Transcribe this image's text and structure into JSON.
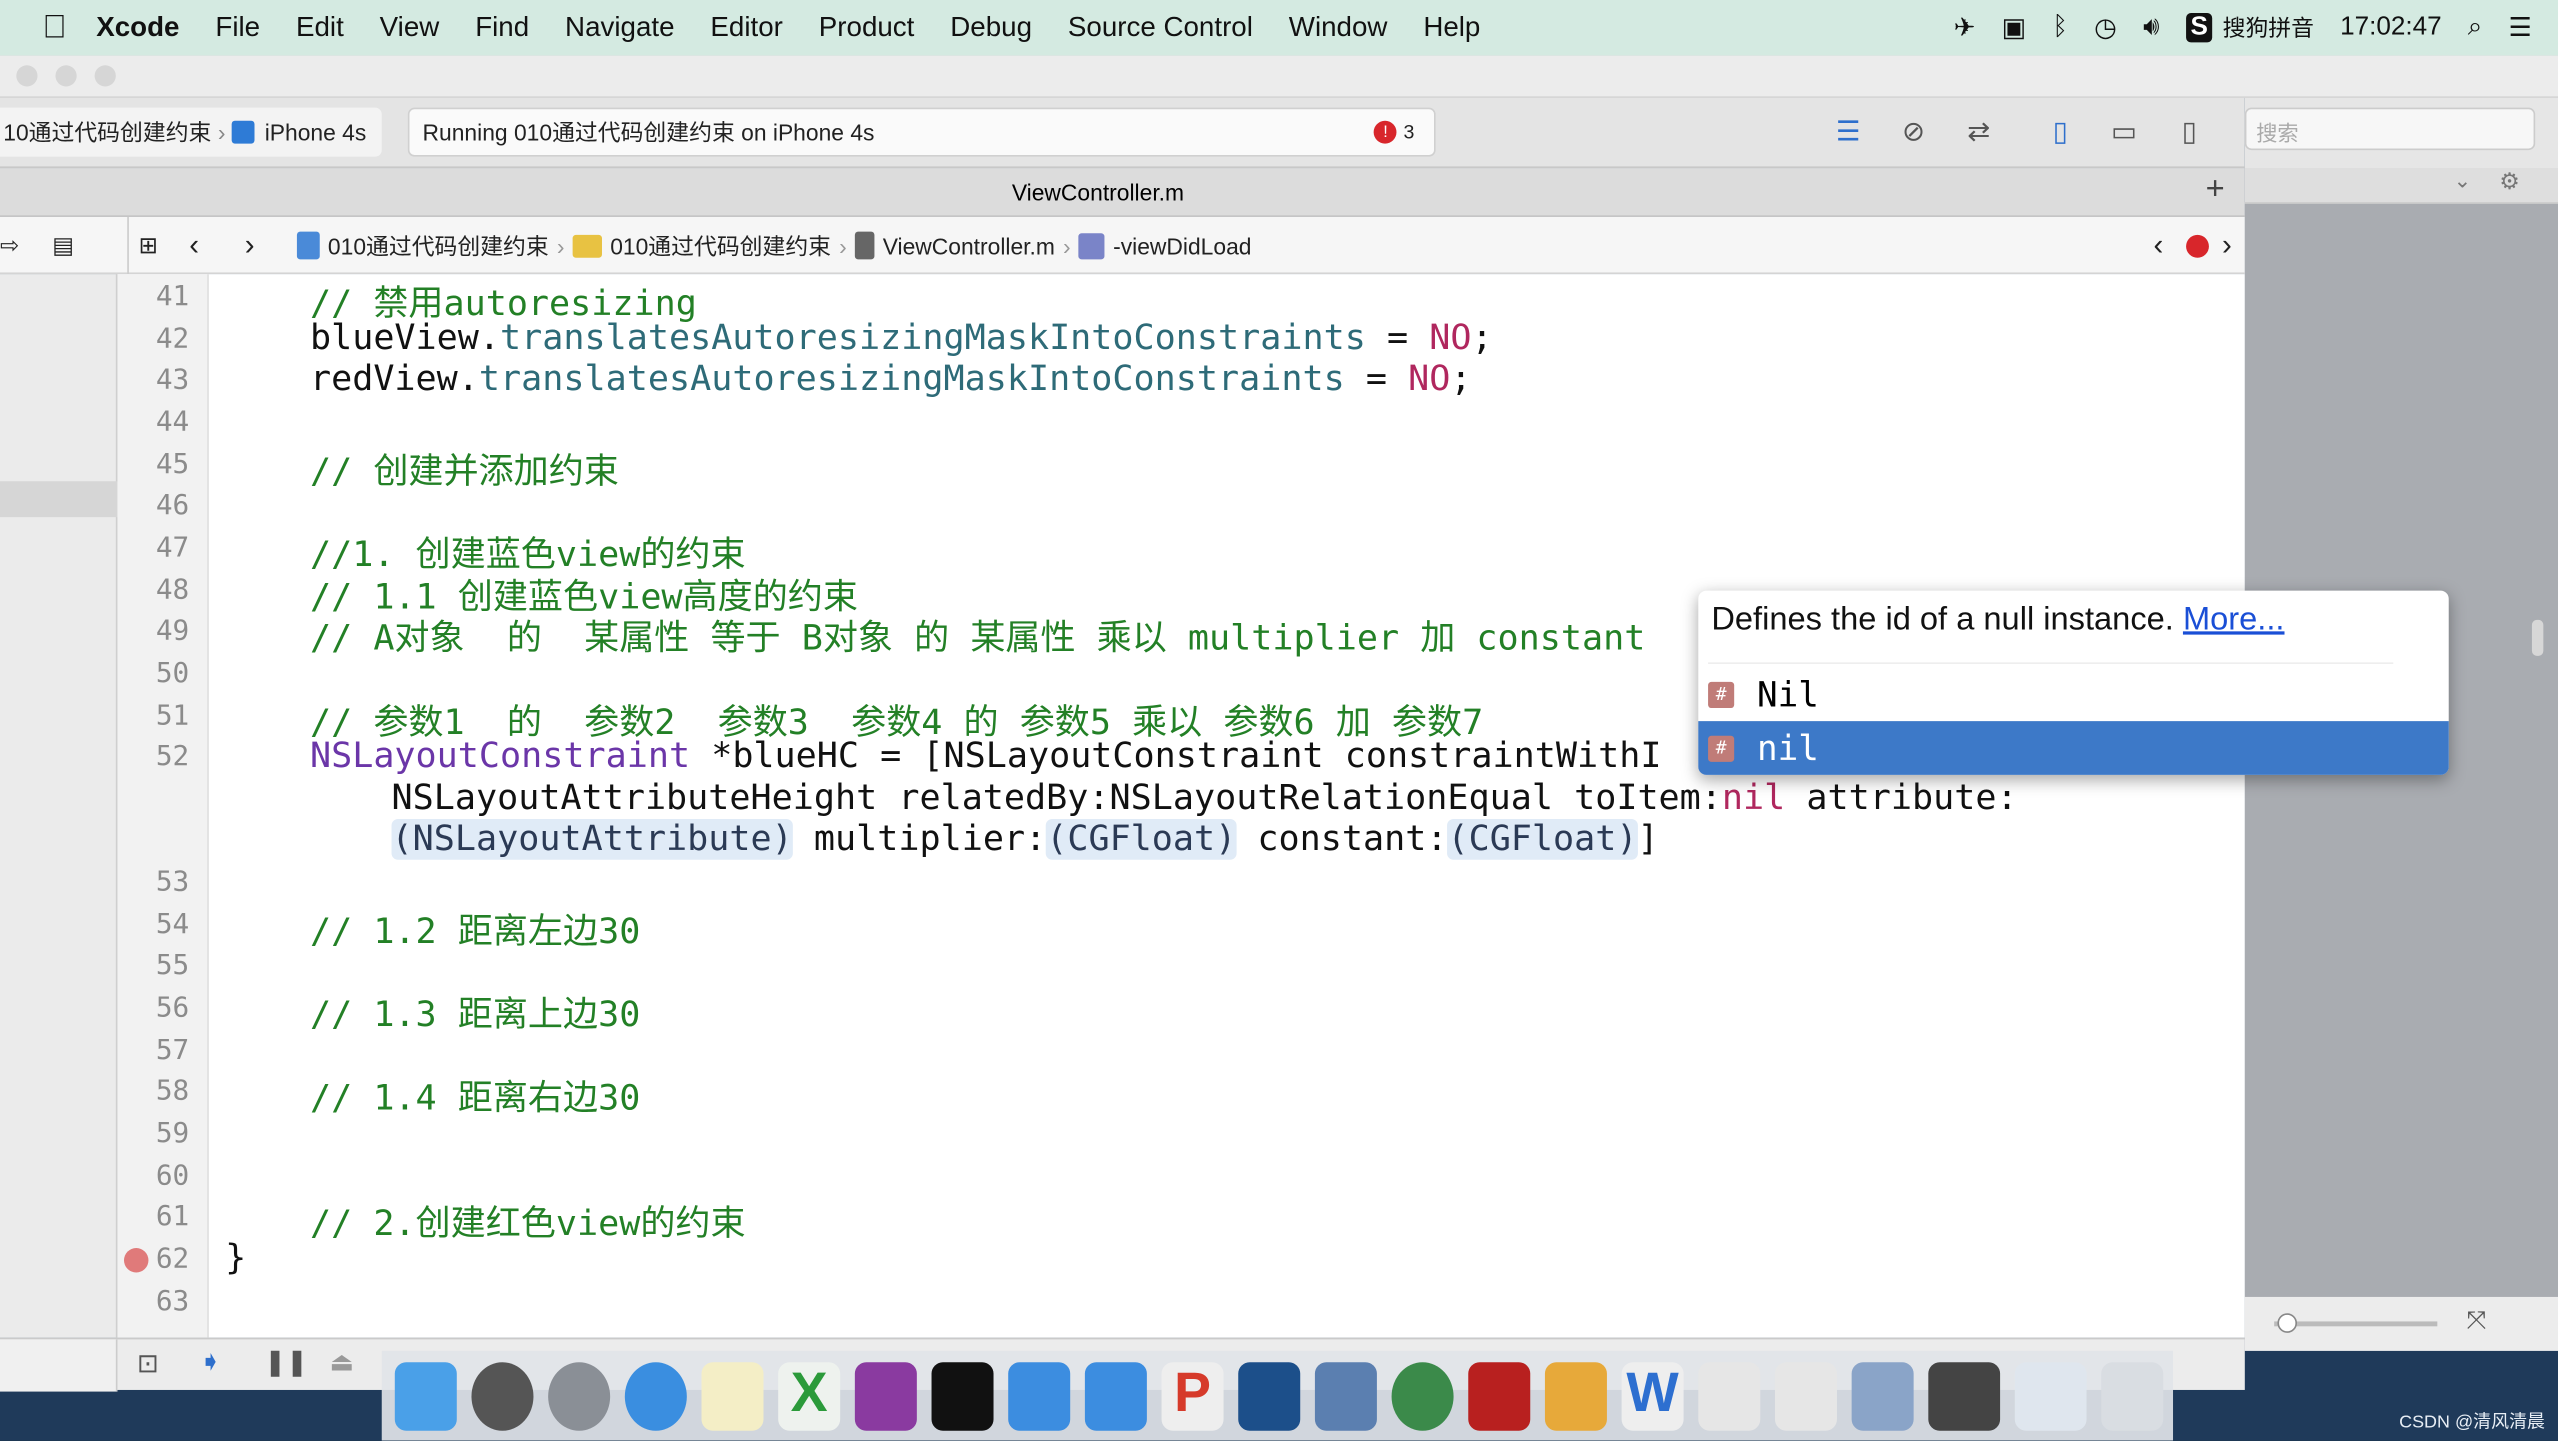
{
  "menubar": {
    "app": "Xcode",
    "items": [
      "File",
      "Edit",
      "View",
      "Find",
      "Navigate",
      "Editor",
      "Product",
      "Debug",
      "Source Control",
      "Window",
      "Help"
    ],
    "input_method": "搜狗拼音",
    "clock": "17:02:47"
  },
  "toolbar": {
    "scheme": "10通过代码创建约束",
    "device": "iPhone 4s",
    "activity": "Running 010通过代码创建约束 on iPhone 4s",
    "error_count": "3",
    "search_placeholder": "搜索"
  },
  "tab": {
    "title": "ViewController.m",
    "add": "+"
  },
  "jumpbar": {
    "crumbs": [
      "010通过代码创建约束",
      "010通过代码创建约束",
      "ViewController.m",
      "-viewDidLoad"
    ]
  },
  "code": [
    {
      "num": "41",
      "segs": [
        [
          "// 禁用autoresizing",
          "com"
        ]
      ]
    },
    {
      "num": "42",
      "segs": [
        [
          "blueView.",
          "t"
        ],
        [
          "translatesAutoresizingMaskIntoConstraints",
          "meth"
        ],
        [
          " = ",
          "t"
        ],
        [
          "NO",
          "kw"
        ],
        [
          ";",
          "t"
        ]
      ]
    },
    {
      "num": "43",
      "segs": [
        [
          "redView.",
          "t"
        ],
        [
          "translatesAutoresizingMaskIntoConstraints",
          "meth"
        ],
        [
          " = ",
          "t"
        ],
        [
          "NO",
          "kw"
        ],
        [
          ";",
          "t"
        ]
      ]
    },
    {
      "num": "44",
      "segs": []
    },
    {
      "num": "45",
      "segs": [
        [
          "// 创建并添加约束",
          "com"
        ]
      ]
    },
    {
      "num": "46",
      "segs": []
    },
    {
      "num": "47",
      "segs": [
        [
          "//1. 创建蓝色view的约束",
          "com"
        ]
      ]
    },
    {
      "num": "48",
      "segs": [
        [
          "// 1.1 创建蓝色view高度的约束",
          "com"
        ]
      ]
    },
    {
      "num": "49",
      "segs": [
        [
          "// A对象  的  某属性 等于 B对象 的 某属性 乘以 multiplier 加 constant",
          "com"
        ]
      ]
    },
    {
      "num": "50",
      "segs": []
    },
    {
      "num": "51",
      "segs": [
        [
          "// 参数1  的  参数2  参数3  参数4 的 参数5 乘以 参数6 加 参数7",
          "com"
        ]
      ]
    },
    {
      "num": "52",
      "segs": [
        [
          "NSLayoutConstraint",
          "cls"
        ],
        [
          " *blueHC = [NSLayoutConstraint constraintWithI",
          "t"
        ]
      ]
    },
    {
      "num": "",
      "indent": true,
      "segs": [
        [
          "NSLayoutAttributeHeight relatedBy:NSLayoutRelationEqual toItem:",
          "t"
        ],
        [
          "nil",
          "kw"
        ],
        [
          " attribute:",
          "t"
        ]
      ]
    },
    {
      "num": "",
      "indent": true,
      "segs": [
        [
          "(NSLayoutAttribute)",
          "ph"
        ],
        [
          " multiplier:",
          "t"
        ],
        [
          "(CGFloat)",
          "ph"
        ],
        [
          " constant:",
          "t"
        ],
        [
          "(CGFloat)",
          "ph"
        ],
        [
          "]",
          "t"
        ]
      ]
    },
    {
      "num": "53",
      "segs": []
    },
    {
      "num": "54",
      "segs": [
        [
          "// 1.2 距离左边30",
          "com"
        ]
      ]
    },
    {
      "num": "55",
      "segs": []
    },
    {
      "num": "56",
      "segs": [
        [
          "// 1.3 距离上边30",
          "com"
        ]
      ]
    },
    {
      "num": "57",
      "segs": []
    },
    {
      "num": "58",
      "segs": [
        [
          "// 1.4 距离右边30",
          "com"
        ]
      ]
    },
    {
      "num": "59",
      "segs": []
    },
    {
      "num": "60",
      "segs": []
    },
    {
      "num": "61",
      "segs": [
        [
          "// 2.创建红色view的约束",
          "com"
        ]
      ]
    },
    {
      "num": "62",
      "segs": [
        [
          "}",
          "t"
        ]
      ]
    },
    {
      "num": "63",
      "segs": []
    }
  ],
  "autocomplete": {
    "description": "Defines the id of a null instance.",
    "more_link": "More...",
    "items": [
      {
        "label": "Nil",
        "selected": false
      },
      {
        "label": "nil",
        "selected": true
      }
    ]
  },
  "colors": {
    "selection": "#3d79c8",
    "comment": "#238026",
    "keyword": "#b0275e"
  },
  "watermark": "CSDN @清风清晨"
}
